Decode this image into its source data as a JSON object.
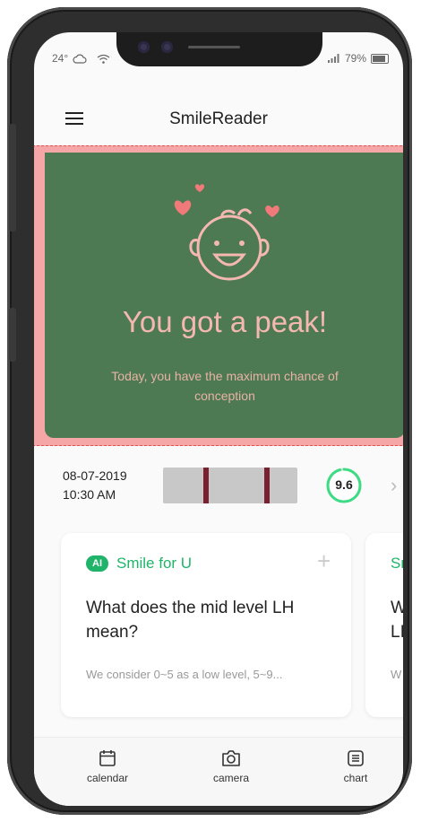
{
  "status_bar": {
    "temperature": "24°",
    "battery": "79%"
  },
  "app_bar": {
    "title": "SmileReader"
  },
  "hero": {
    "title": "You got a peak!",
    "subtitle": "Today, you have the maximum chance of conception",
    "background_color": "#4d7a52",
    "text_color": "#f4b8b1"
  },
  "result": {
    "date": "08-07-2019",
    "time": "10:30 AM",
    "score": "9.6",
    "score_level": 0.96,
    "accent_color": "#3ddc84"
  },
  "cards": [
    {
      "badge": "AI",
      "brand": "Smile for U",
      "question": "What does the mid level LH mean?",
      "body": "We consider 0~5 as a low level, 5~9..."
    },
    {
      "brand": "Sr",
      "question_line1": "W",
      "question_line2": "LI",
      "body": "W"
    }
  ],
  "nav": {
    "items": [
      {
        "label": "calendar",
        "icon": "calendar-icon"
      },
      {
        "label": "camera",
        "icon": "camera-icon"
      },
      {
        "label": "chart",
        "icon": "list-icon"
      }
    ]
  }
}
